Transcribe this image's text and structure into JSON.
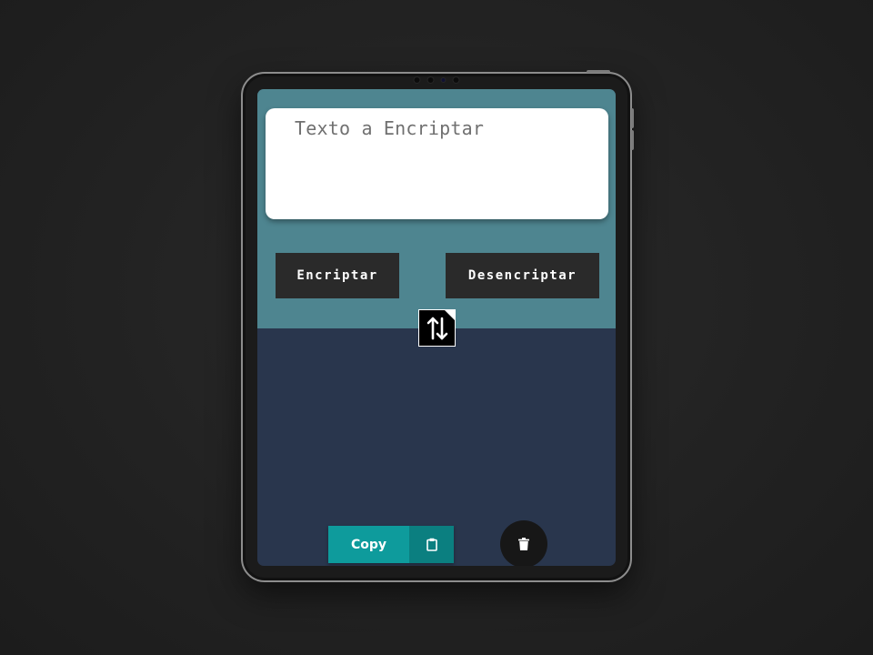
{
  "input": {
    "placeholder": "Texto a Encriptar",
    "value": ""
  },
  "actions": {
    "encrypt_label": "Encriptar",
    "decrypt_label": "Desencriptar"
  },
  "swap": {
    "icon": "swap-vertical-arrows-icon"
  },
  "output": {
    "copy_label": "Copy",
    "copy_icon": "clipboard-icon",
    "clear_icon": "trash-icon"
  },
  "colors": {
    "top_panel": "#4e8590",
    "bottom_panel": "#29364d",
    "action_button": "#2a2a2a",
    "copy_accent": "#0e9b9c",
    "copy_icon_bg": "#0b7f80",
    "trash_button": "#171717"
  }
}
